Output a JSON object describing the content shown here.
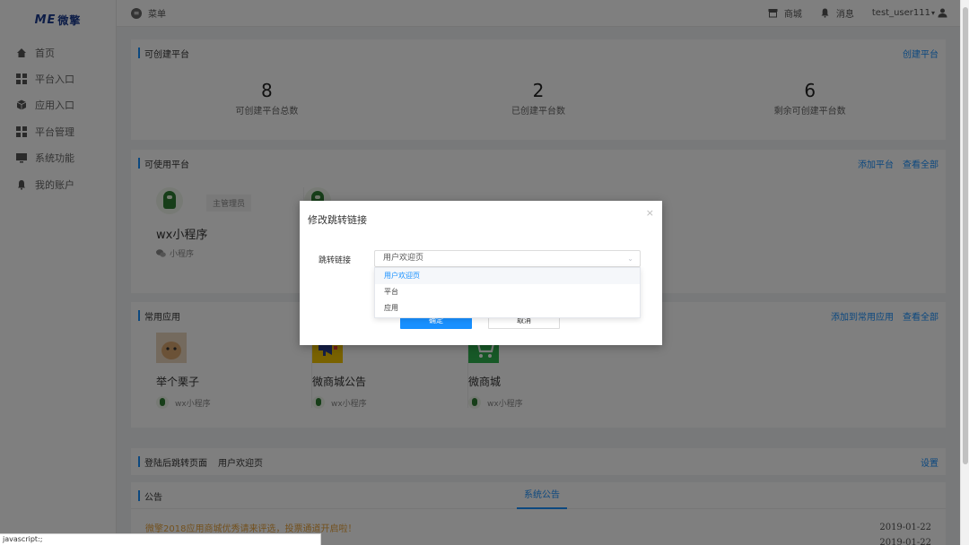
{
  "logo": {
    "mark": "ME",
    "text": "微擎"
  },
  "sidebar": {
    "items": [
      {
        "label": "首页",
        "icon": "home-icon"
      },
      {
        "label": "平台入口",
        "icon": "grid-icon"
      },
      {
        "label": "应用入口",
        "icon": "cube-icon"
      },
      {
        "label": "平台管理",
        "icon": "grid-icon"
      },
      {
        "label": "系统功能",
        "icon": "monitor-icon"
      },
      {
        "label": "我的账户",
        "icon": "bell-icon"
      }
    ]
  },
  "topbar": {
    "menu_icon": "≡",
    "menu_label": "菜单",
    "store_label": "商城",
    "message_label": "消息",
    "user_label": "test_user111",
    "user_caret": "▾"
  },
  "creatable": {
    "title": "可创建平台",
    "action": "创建平台",
    "stats": [
      {
        "value": "8",
        "label": "可创建平台总数"
      },
      {
        "value": "2",
        "label": "已创建平台数"
      },
      {
        "value": "6",
        "label": "剩余可创建平台数"
      }
    ]
  },
  "usable": {
    "title": "可使用平台",
    "action_add": "添加平台",
    "action_all": "查看全部",
    "platforms": [
      {
        "role": "主管理员",
        "name": "wx小程序",
        "type": "小程序"
      }
    ]
  },
  "common_apps": {
    "title": "常用应用",
    "action_add": "添加到常用应用",
    "action_all": "查看全部",
    "apps": [
      {
        "name": "举个栗子",
        "platform": "wx小程序",
        "color": "#c9a98a"
      },
      {
        "name": "微商城公告",
        "platform": "wx小程序",
        "color": "#f2c500"
      },
      {
        "name": "微商城",
        "platform": "wx小程序",
        "color": "#2fb24f"
      }
    ]
  },
  "redirect": {
    "label": "登陆后跳转页面",
    "value": "用户欢迎页",
    "action": "设置"
  },
  "notice": {
    "title": "公告",
    "tab": "系统公告",
    "items": [
      {
        "text": "微擎2018应用商城优秀请来评选，投票通道开启啦！",
        "date": "2019-01-22"
      },
      {
        "text": "",
        "date": "2019-01-22"
      }
    ]
  },
  "modal": {
    "title": "修改跳转链接",
    "close": "×",
    "field_label": "跳转链接",
    "selected": "用户欢迎页",
    "options": [
      "用户欢迎页",
      "平台",
      "应用"
    ],
    "ok": "确定",
    "cancel": "取消"
  },
  "statusbar": {
    "text": "javascript:;"
  },
  "colors": {
    "accent": "#1890ff",
    "notice": "#e6a23c",
    "overlay": "rgba(0,0,0,0.5)"
  }
}
